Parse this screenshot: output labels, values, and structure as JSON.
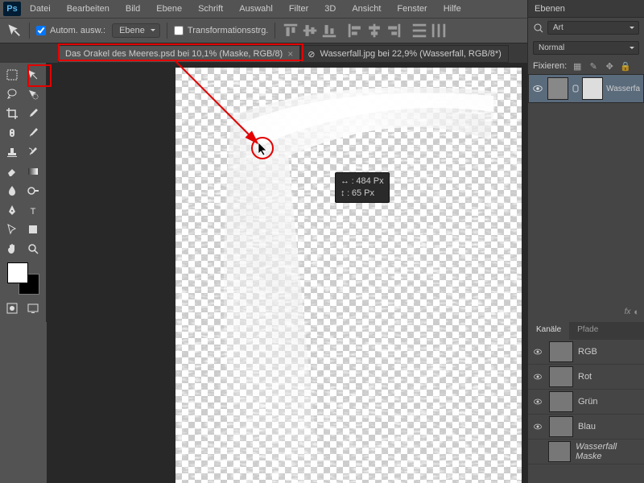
{
  "app": {
    "logo": "Ps"
  },
  "menu": [
    "Datei",
    "Bearbeiten",
    "Bild",
    "Ebene",
    "Schrift",
    "Auswahl",
    "Filter",
    "3D",
    "Ansicht",
    "Fenster",
    "Hilfe"
  ],
  "optbar": {
    "auto_select": "Autom. ausw.:",
    "auto_select_checked": true,
    "layer_select": "Ebene",
    "transform_controls": "Transformationsstrg.",
    "transform_checked": false
  },
  "tabs": [
    {
      "label": "Das Orakel des Meeres.psd bei 10,1% (Maske, RGB/8)",
      "active": true
    },
    {
      "label": "Wasserfall.jpg bei 22,9% (Wasserfall, RGB/8*)",
      "active": false
    }
  ],
  "tooltip": {
    "w_label": "↔",
    "w": "484 Px",
    "h_label": "↕",
    "h": "65 Px"
  },
  "panels": {
    "layers_title": "Ebenen",
    "kind": "Art",
    "blend": "Normal",
    "lock_label": "Fixieren:",
    "layer_name": "Wasserfa",
    "channels_title": "Kanäle",
    "paths_title": "Pfade",
    "channels": [
      "RGB",
      "Rot",
      "Grün",
      "Blau",
      "Wasserfall Maske"
    ]
  },
  "colors": {
    "accent": "#e30000"
  }
}
